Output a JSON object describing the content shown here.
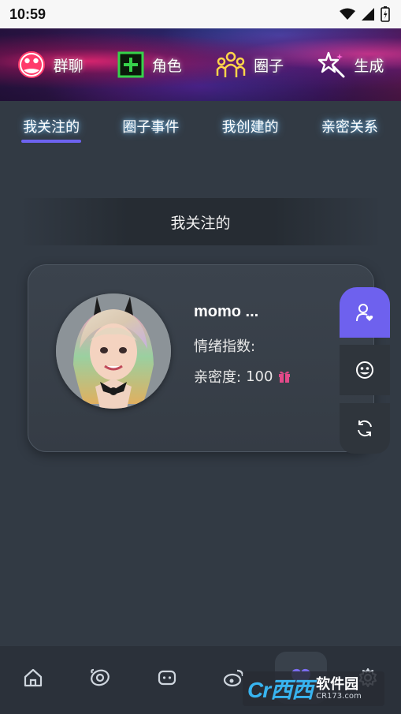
{
  "status_bar": {
    "time": "10:59"
  },
  "banner": {
    "items": [
      {
        "label": "群聊",
        "icon": "group-chat-icon",
        "color": "#ff3b6b"
      },
      {
        "label": "角色",
        "icon": "add-character-icon",
        "color": "#36d24a"
      },
      {
        "label": "圈子",
        "icon": "circle-people-icon",
        "color": "#ffd54a"
      },
      {
        "label": "生成",
        "icon": "magic-wand-icon",
        "color": "#ff6ad5"
      }
    ]
  },
  "tabs": [
    {
      "label": "我关注的",
      "active": true
    },
    {
      "label": "圈子事件",
      "active": false
    },
    {
      "label": "我创建的",
      "active": false
    },
    {
      "label": "亲密关系",
      "active": false
    }
  ],
  "section": {
    "title": "我关注的"
  },
  "card": {
    "name": "momo ...",
    "emotion_label": "情绪指数:",
    "intimacy_label": "亲密度:",
    "intimacy_value": "100",
    "accent": "#e24a8a"
  },
  "side_actions": [
    {
      "name": "follow",
      "icon": "user-heart-icon"
    },
    {
      "name": "chat",
      "icon": "face-icon"
    },
    {
      "name": "refresh",
      "icon": "refresh-icon"
    }
  ],
  "bottom_nav": [
    {
      "icon": "home-icon"
    },
    {
      "icon": "circle-swirl-icon"
    },
    {
      "icon": "chat-bot-icon"
    },
    {
      "icon": "weibo-icon"
    },
    {
      "icon": "heart-icon",
      "active": true
    },
    {
      "icon": "settings-icon"
    }
  ],
  "watermark": {
    "logo": "Cr西西",
    "text": "软件园",
    "url": "CR173.com"
  },
  "colors": {
    "accent": "#6e61ee",
    "background": "#323a44",
    "nav_bg": "#2b313a"
  }
}
